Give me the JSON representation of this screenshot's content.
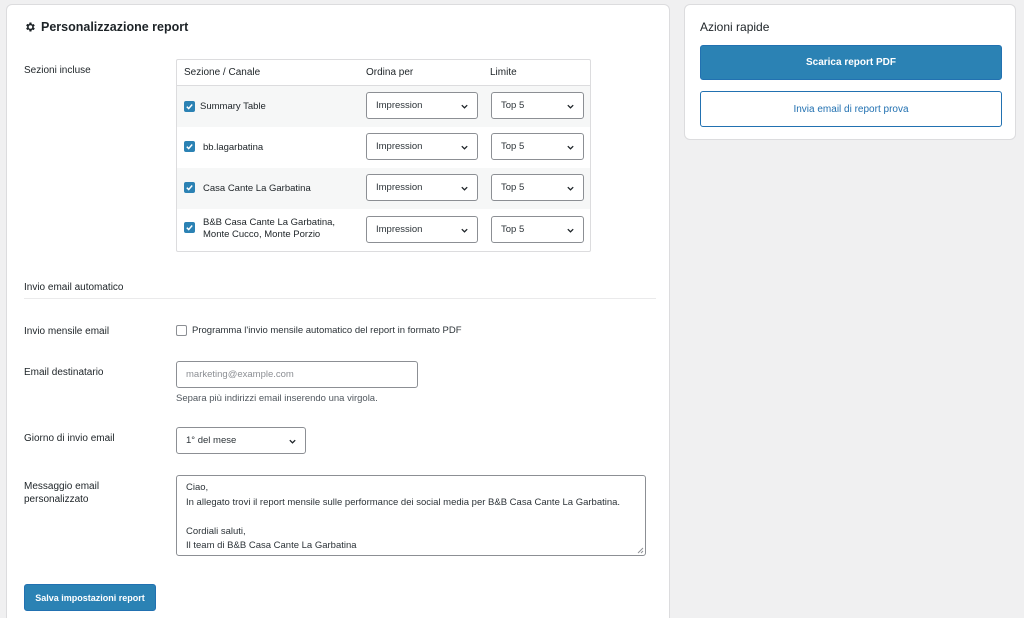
{
  "main_panel": {
    "title": "Personalizzazione report",
    "sections": {
      "label": "Sezioni incluse",
      "columns": [
        "Sezione / Canale",
        "Ordina per",
        "Limite"
      ],
      "rows": [
        {
          "name": "Summary Table",
          "checked": true,
          "sort": "Impression",
          "limit": "Top 5"
        },
        {
          "name": "bb.lagarbatina",
          "checked": true,
          "sort": "Impression",
          "limit": "Top 5"
        },
        {
          "name": "Casa Cante La Garbatina",
          "checked": true,
          "sort": "Impression",
          "limit": "Top 5"
        },
        {
          "name_line1": "B&B Casa Cante La Garbatina,",
          "name_line2": "Monte Cucco, Monte Porzio",
          "checked": true,
          "sort": "Impression",
          "limit": "Top 5"
        }
      ]
    },
    "email": {
      "heading": "Invio email automatico",
      "monthly_label": "Invio mensile email",
      "monthly_checkbox_label": "Programma l'invio mensile automatico del report in formato PDF",
      "monthly_checked": false,
      "recipient_label": "Email destinatario",
      "recipient_placeholder": "marketing@example.com",
      "recipient_help": "Separa più indirizzi email inserendo una virgola.",
      "day_label": "Giorno di invio email",
      "day_value": "1° del mese",
      "message_label_line1": "Messaggio email",
      "message_label_line2": "personalizzato",
      "message_text": "Ciao,\nIn allegato trovi il report mensile sulle performance dei social media per B&B Casa Cante La Garbatina.\n\nCordiali saluti,\nIl team di B&B Casa Cante La Garbatina"
    },
    "save_button": "Salva impostazioni report"
  },
  "side_panel": {
    "title": "Azioni rapide",
    "download_button": "Scarica report PDF",
    "test_email_button": "Invia email di report prova"
  },
  "colors": {
    "accent": "#2b82b4",
    "border": "#dcdcde",
    "background": "#f0f0f1"
  }
}
